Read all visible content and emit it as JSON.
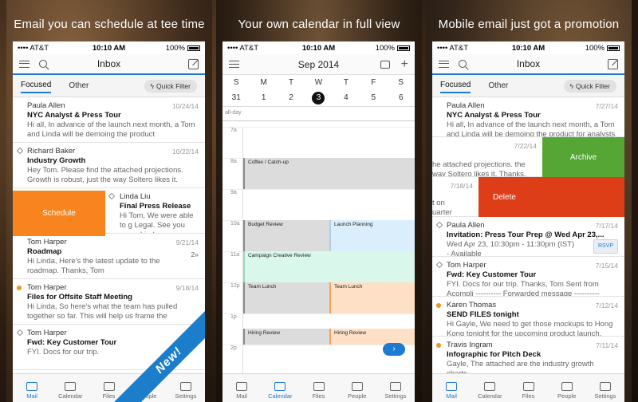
{
  "status": {
    "carrier": "•••• AT&T",
    "time": "10:10 AM",
    "battery": "100%"
  },
  "panel1": {
    "caption": "Email you can schedule at tee time",
    "title": "Inbox",
    "tabs": [
      "Focused",
      "Other"
    ],
    "quick_filter": "Quick Filter",
    "mails": [
      {
        "from": "Paula Allen",
        "subject": "NYC Analyst & Press Tour",
        "preview": "Hi all, In advance of the launch next month, a Tom and Linda will be demoing the product",
        "date": "10/24/14"
      },
      {
        "from": "Richard Baker",
        "subject": "Industry Growth",
        "preview": "Hey Tom. Please find the attached projections. Growth is robust, just the way Soltero likes it.",
        "date": "10/22/14"
      },
      {
        "from": "Linda Liu",
        "subject": "Final Press Release",
        "preview": "Hi Tom, We were able to g Legal. See you soon, Linda",
        "date": ""
      },
      {
        "from": "Tom Harper",
        "subject": "Roadmap",
        "preview": "Hi Linda, Here's the latest update to the roadmap. Thanks, Tom",
        "date": "9/21/14",
        "count": "2»"
      },
      {
        "from": "Tom Harper",
        "subject": "Files for Offsite Staff Meeting",
        "preview": "Hi Linda, So here's what the team has pulled together so far. This will help us frame the",
        "date": "9/18/14"
      },
      {
        "from": "Tom Harper",
        "subject": "Fwd: Key Customer Tour",
        "preview": "FYI. Docs for our trip.",
        "date": "9/"
      }
    ],
    "swipe_label": "Schedule",
    "ribbon": "New!"
  },
  "panel2": {
    "caption": "Your own calendar in full view",
    "title": "Sep 2014",
    "weekdays": [
      "S",
      "M",
      "T",
      "W",
      "T",
      "F",
      "S"
    ],
    "dates": [
      "31",
      "1",
      "2",
      "3",
      "4",
      "5",
      "6"
    ],
    "allday": "all-day",
    "hours": [
      "7a",
      "8a",
      "9a",
      "10a",
      "11a",
      "12p",
      "1p",
      "2p"
    ],
    "events": {
      "coffee": "Coffee / Catch-up",
      "budget": "Budget Review",
      "launch": "Launch Planning",
      "campaign": "Campaign Creative Review",
      "lunch1": "Team Lunch",
      "lunch2": "Team Lunch",
      "hiring1": "Hiring Review",
      "hiring2": "Hiring Review"
    },
    "fab": "›"
  },
  "panel3": {
    "caption": "Mobile email just got a promotion",
    "title": "Inbox",
    "tabs": [
      "Focused",
      "Other"
    ],
    "quick_filter": "Quick Filter",
    "mails": [
      {
        "from": "Paula Allen",
        "subject": "NYC Analyst & Press Tour",
        "preview": "Hi all, In advance of the launch next month, a Tom and Linda will be demoing the product for analysts",
        "date": "7/27/14"
      },
      {
        "from": "",
        "subject": "",
        "preview": "he attached projections. the way Soltero likes it. Thanks,",
        "date": "7/22/14"
      },
      {
        "from": "",
        "subject": "",
        "preview": "t on uarter",
        "date": "7/18/14"
      },
      {
        "from": "Paula Allen",
        "subject": "Invitation: Press Tour Prep @ Wed Apr 23,...",
        "preview": "Wed Apr 23, 10:30pm - 11:30pm (IST) - Available",
        "date": "7/17/14"
      },
      {
        "from": "Tom Harper",
        "subject": "Fwd: Key Customer Tour",
        "preview": "FYI. Docs for our trip. Thanks, Tom Sent from Acompli ---------- Forwarded message ----------",
        "date": "7/15/14"
      },
      {
        "from": "Karen Thomas",
        "subject": "SEND FILES tonight",
        "preview": "Hi Gayle, We need to get those mockups to Hong Kong tonight for the upcoming product launch. Sorry",
        "date": "7/12/14"
      },
      {
        "from": "Travis Ingram",
        "subject": "Infographic for Pitch Deck",
        "preview": "Gayle, The attached are the industry growth charts",
        "date": "7/11/14"
      }
    ],
    "archive_label": "Archive",
    "delete_label": "Delete",
    "rsvp": "RSVP"
  },
  "tabbar": [
    "Mail",
    "Calendar",
    "Files",
    "People",
    "Settings"
  ],
  "colors": {
    "accent": "#1e7bd2",
    "schedule": "#f7841e",
    "archive": "#55a634",
    "delete": "#dd3e18",
    "unread_dot": "#f0961e"
  }
}
